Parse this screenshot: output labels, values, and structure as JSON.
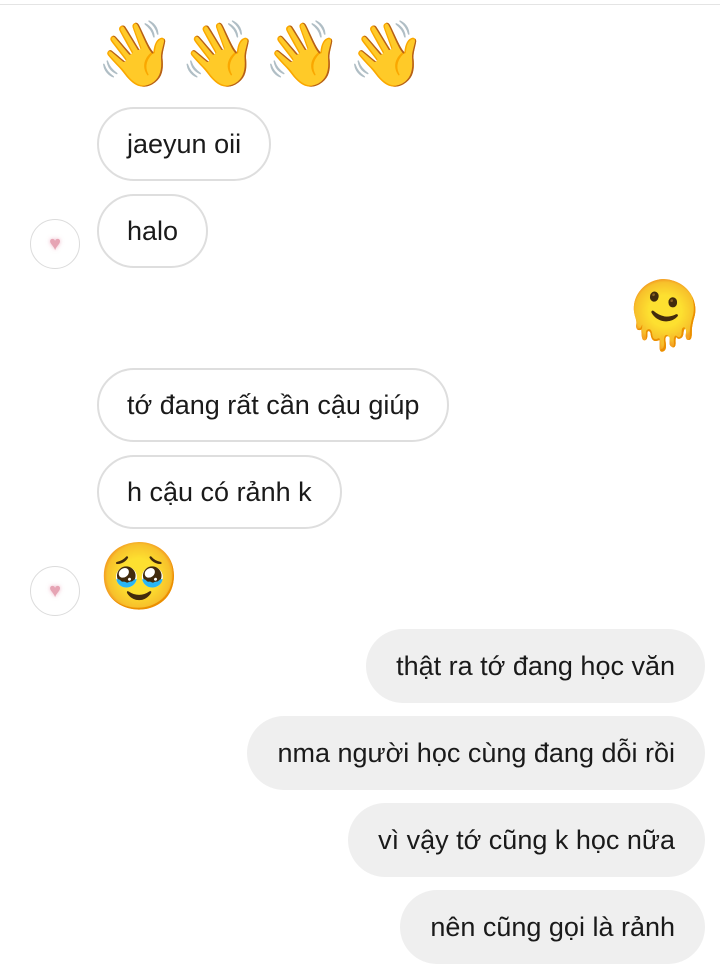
{
  "chat": {
    "messages": [
      {
        "side": "in",
        "type": "emoji",
        "content": "👋👋👋👋"
      },
      {
        "side": "in",
        "type": "text",
        "content": "jaeyun oii"
      },
      {
        "side": "in",
        "type": "text",
        "content": "halo"
      },
      {
        "side": "out",
        "type": "emoji",
        "content": "🫠"
      },
      {
        "side": "in",
        "type": "text",
        "content": "tớ đang rất cần cậu giúp"
      },
      {
        "side": "in",
        "type": "text",
        "content": "h cậu có rảnh k"
      },
      {
        "side": "in",
        "type": "emoji",
        "content": "🥹"
      },
      {
        "side": "out",
        "type": "text",
        "content": "thật ra tớ đang học văn"
      },
      {
        "side": "out",
        "type": "text",
        "content": "nma người học cùng đang dỗi rồi"
      },
      {
        "side": "out",
        "type": "text",
        "content": "vì vậy tớ cũng k học nữa"
      },
      {
        "side": "out",
        "type": "text",
        "content": "nên cũng gọi là rảnh"
      }
    ],
    "wave_emojis": [
      "👋",
      "👋",
      "👋",
      "👋"
    ],
    "avatar_icon": "heart-icon",
    "colors": {
      "incoming_border": "#dedede",
      "outgoing_bg": "#efefef",
      "avatar_heart": "#e6a4b4"
    }
  }
}
